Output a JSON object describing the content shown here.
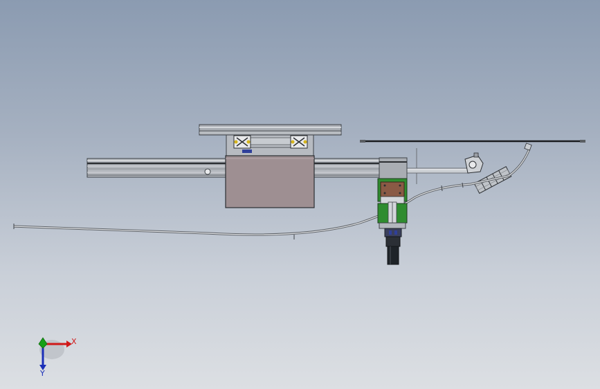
{
  "viewport": {
    "background_top": "#8b9bb1",
    "background_bottom": "#dcdfe3"
  },
  "model": {
    "components": [
      "top-plate",
      "guide-rail",
      "slider-carriage",
      "bearing-block-left",
      "bearing-block-right",
      "vertical-module",
      "gripper-cylinder",
      "drive-shaft",
      "pivot-bracket",
      "coupling",
      "cable-hose",
      "support-bar"
    ],
    "colors": {
      "metal_light": "#d4d6da",
      "metal_mid": "#a9adb3",
      "metal_dark": "#3e4247",
      "carriage": "#9e8f92",
      "module_green": "#2f8c2f",
      "module_brown": "#8a5a45",
      "cylinder": "#1e2328",
      "accent_yellow": "#d6b51e",
      "accent_blue": "#2f3f9a"
    }
  },
  "triad": {
    "x_label": "X",
    "y_label": "Y",
    "x_color": "#d01818",
    "y_color": "#16a016",
    "z_color": "#1b2fb8"
  }
}
